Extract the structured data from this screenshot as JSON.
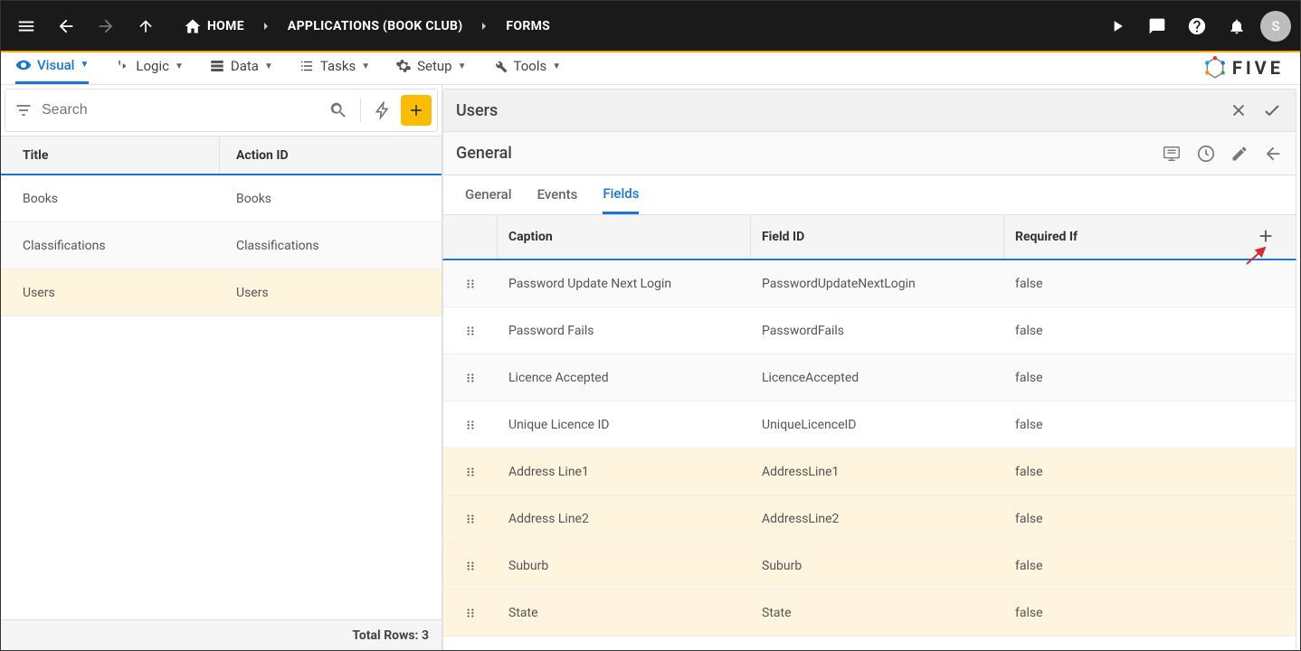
{
  "topbar": {
    "home": "HOME",
    "crumb1": "APPLICATIONS (BOOK CLUB)",
    "crumb2": "FORMS",
    "avatar": "S"
  },
  "sectabs": {
    "visual": "Visual",
    "logic": "Logic",
    "data": "Data",
    "tasks": "Tasks",
    "setup": "Setup",
    "tools": "Tools"
  },
  "logo": "FIVE",
  "left": {
    "search_placeholder": "Search",
    "col_title": "Title",
    "col_action": "Action ID",
    "rows": [
      {
        "title": "Books",
        "action": "Books"
      },
      {
        "title": "Classifications",
        "action": "Classifications"
      },
      {
        "title": "Users",
        "action": "Users"
      }
    ],
    "footer": "Total Rows: 3"
  },
  "right": {
    "head_title": "Users",
    "section_title": "General",
    "tabs": {
      "general": "General",
      "events": "Events",
      "fields": "Fields"
    },
    "cols": {
      "caption": "Caption",
      "fieldid": "Field ID",
      "requiredif": "Required If"
    },
    "rows": [
      {
        "caption": "Password Update Next Login",
        "fieldid": "PasswordUpdateNextLogin",
        "req": "false",
        "hl": false
      },
      {
        "caption": "Password Fails",
        "fieldid": "PasswordFails",
        "req": "false",
        "hl": false
      },
      {
        "caption": "Licence Accepted",
        "fieldid": "LicenceAccepted",
        "req": "false",
        "hl": false
      },
      {
        "caption": "Unique Licence ID",
        "fieldid": "UniqueLicenceID",
        "req": "false",
        "hl": false
      },
      {
        "caption": "Address Line1",
        "fieldid": "AddressLine1",
        "req": "false",
        "hl": true
      },
      {
        "caption": "Address Line2",
        "fieldid": "AddressLine2",
        "req": "false",
        "hl": true
      },
      {
        "caption": "Suburb",
        "fieldid": "Suburb",
        "req": "false",
        "hl": true
      },
      {
        "caption": "State",
        "fieldid": "State",
        "req": "false",
        "hl": true
      }
    ]
  }
}
